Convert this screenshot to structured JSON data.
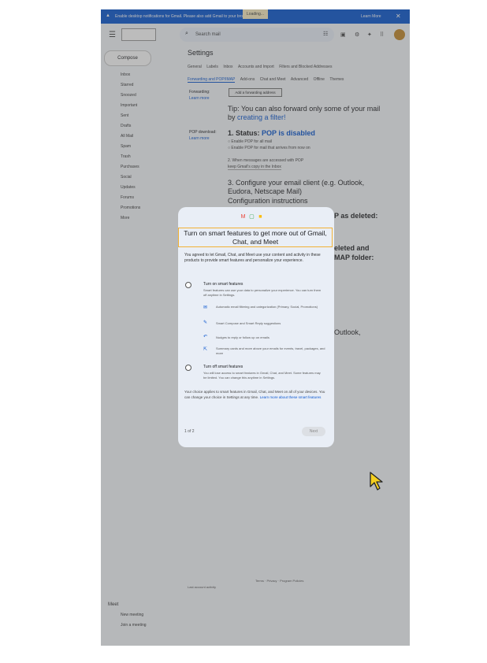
{
  "banner": {
    "message": "Enable desktop notifications for Gmail. Please also add Gmail to your browser",
    "loading": "Loading...",
    "learn_more": "Learn More",
    "close_icon": "close-icon"
  },
  "topbar": {
    "search_placeholder": "Search mail"
  },
  "sidebar": {
    "compose": "Compose",
    "items": [
      "Inbox",
      "Starred",
      "Snoozed",
      "Important",
      "Sent",
      "Drafts",
      "All Mail",
      "Spam",
      "Trash",
      "Purchases",
      "Social",
      "Updates",
      "Forums",
      "Promotions",
      "More"
    ],
    "meet_header": "Meet",
    "meet_items": [
      "New meeting",
      "Join a meeting"
    ]
  },
  "settings": {
    "title": "Settings",
    "tabs1": [
      "General",
      "Labels",
      "Inbox",
      "Accounts and Import",
      "Filters and Blocked Addresses"
    ],
    "tabs2": [
      "Forwarding and POP/IMAP",
      "Add-ons",
      "Chat and Meet",
      "Advanced",
      "Offline",
      "Themes"
    ],
    "forwarding_label": "Forwarding:",
    "learn_more": "Learn more",
    "add_forwarding": "Add a forwarding address",
    "tip_prefix": "Tip: You can also forward only some of your mail by ",
    "tip_link": "creating a filter!",
    "pop_label": "POP download:",
    "pop_status_prefix": "1. Status: ",
    "pop_status": "POP is disabled",
    "pop_opt1": "Enable POP for all mail",
    "pop_opt2": "Enable POP for mail that arrives from now on",
    "pop_when": "2. When messages are accessed with POP",
    "pop_keep": "keep Gmail's copy in the Inbox",
    "configure": "3. Configure your email client (e.g. Outlook, Eudora, Netscape Mail)",
    "config_link": "Configuration instructions",
    "right1": "P as deleted:",
    "right2": "eleted and",
    "right3": "MAP folder:",
    "right4": "Outlook,",
    "footer_terms": "Terms · Privacy · Program Policies",
    "footer_activity": "Last account activity"
  },
  "modal": {
    "title": "Turn on smart features to get more out of Gmail, Chat, and Meet",
    "desc": "You agreed to let Gmail, Chat, and Meet use your content and activity in these products to provide smart features and personalize your experience.",
    "option1_title": "Turn on smart features",
    "option1_desc": "Smart features can use your data to personalize your experience. You can turn them off anytime in Settings.",
    "features": [
      {
        "icon": "mail-icon",
        "text": "Automatic email filtering and categorization (Primary, Social, Promotions)"
      },
      {
        "icon": "pencil-icon",
        "text": "Smart Compose and Smart Reply suggestions"
      },
      {
        "icon": "reply-icon",
        "text": "Nudges to reply or follow up on emails"
      },
      {
        "icon": "open-in-new-icon",
        "text": "Summary cards and more above your emails for events, travel, packages, and more"
      }
    ],
    "option2_title": "Turn off smart features",
    "option2_desc": "You will lose access to smart features in Gmail, Chat, and Meet. Some features may be limited. You can change this anytime in Settings.",
    "note_prefix": "Your choice applies to smart features in Gmail, Chat, and Meet on all of your devices. You can change your choice in Settings at any time. ",
    "note_link": "Learn more about these smart features",
    "step": "1 of 2",
    "next": "Next"
  }
}
